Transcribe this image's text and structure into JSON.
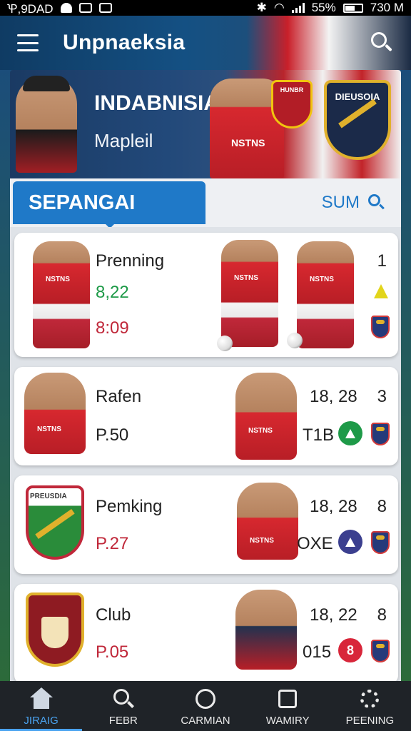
{
  "status_bar": {
    "left_text": "Ꝕ,9DAD",
    "battery": "55%",
    "time": "730 M"
  },
  "header": {
    "title": "Unpnaeksia",
    "menu_icon": "hamburger-menu-icon",
    "search_icon": "search-icon"
  },
  "hero": {
    "title": "INDABNISIA",
    "subtitle": "Mapleil",
    "player_shirt": "NSTNS",
    "badge_small": "HUNBR",
    "badge_large": "DIEUSOIA"
  },
  "section": {
    "tab_label": "SEPANGAI",
    "link_label": "SUM"
  },
  "cards": [
    {
      "name": "Prenning",
      "value1": "8,22",
      "value2": "8:09",
      "rank": "1"
    },
    {
      "name": "Rafen",
      "value1": "P.50",
      "score": "18, 28",
      "rank": "3",
      "code": "T1B"
    },
    {
      "name": "Pemking",
      "value1": "P.27",
      "score": "18, 28",
      "rank": "8",
      "code": "OXE",
      "crest_text": "PREUSDIA"
    },
    {
      "name": "Club",
      "value1": "P.05",
      "score": "18, 22",
      "rank": "8",
      "code": "015"
    }
  ],
  "nav": [
    {
      "label": "JIRAIG",
      "icon": "home-icon"
    },
    {
      "label": "FEBR",
      "icon": "search-icon"
    },
    {
      "label": "CARMIAN",
      "icon": "circle-icon"
    },
    {
      "label": "WAMIRY",
      "icon": "square-icon"
    },
    {
      "label": "PEENING",
      "icon": "gear-icon"
    }
  ],
  "colors": {
    "accent": "#1f79c8",
    "green_value": "#1e9a48",
    "red_value": "#c0283a",
    "nav_bg": "#1f2328"
  }
}
